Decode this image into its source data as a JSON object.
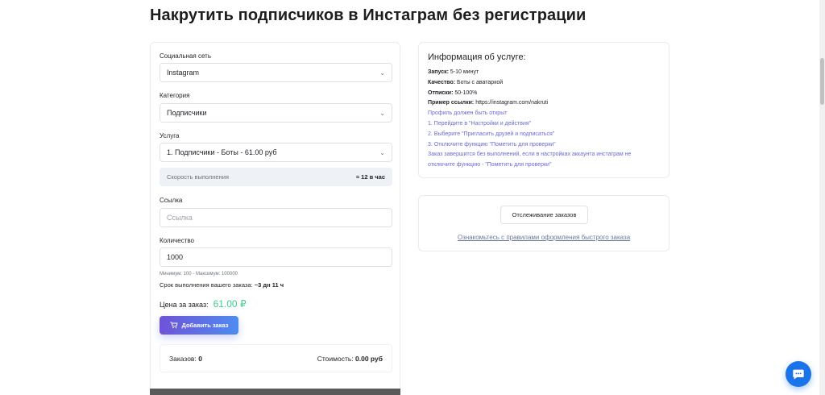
{
  "page": {
    "title": "Накрутить подписчиков в Инстаграм без регистрации"
  },
  "form": {
    "network_label": "Социальная сеть",
    "network_value": "Instagram",
    "category_label": "Категория",
    "category_value": "Подписчики",
    "service_label": "Услуга",
    "service_value": "1. Подписчики - Боты - 61.00 руб",
    "speed_label": "Скорость выполнения",
    "speed_value": "≈ 12 в час",
    "link_label": "Ссылка",
    "link_placeholder": "Ссылка",
    "quantity_label": "Количество",
    "quantity_value": "1000",
    "quantity_hint": "Минимум: 100 - Максимум: 100000",
    "term_label": "Срок выполнения вашего заказа:",
    "term_value": "~3 дн 11 ч",
    "price_label": "Цена за заказ:",
    "price_value": "61.00 ₽",
    "add_button": "Добавить заказ"
  },
  "summary": {
    "orders_label": "Заказов:",
    "orders_value": "0",
    "cost_label": "Стоимость:",
    "cost_value": "0.00 руб"
  },
  "info": {
    "title": "Информация об услуге:",
    "start_label": "Запуск:",
    "start_value": "5-10 минут",
    "quality_label": "Качество:",
    "quality_value": "Боты с аватаркой",
    "unsub_label": "Отписки:",
    "unsub_value": "50-100%",
    "example_label": "Пример ссылки:",
    "example_value": "https://instagram.com/nakruti",
    "notes": [
      "Профиль должен быть открыт",
      "1. Перейдите в \"Настройки и действия\"",
      "2. Выберите \"Пригласить друзей и подписаться\"",
      "3. Отключите функцию \"Пометить для проверки\"",
      "Заказ завершится без выполнений, если в настройках аккаунта инстаграм не",
      "отключите функцию - \"Пометить для проверки\""
    ]
  },
  "tracking": {
    "button": "Отслеживание заказов",
    "rules_link": "Ознакомьтесь с правилами оформления быстрого заказа"
  },
  "icons": {
    "chevron": "chevron-down-icon",
    "cart": "cart-icon",
    "chat": "chat-icon"
  },
  "colors": {
    "accent_gradient_start": "#6f52d8",
    "accent_gradient_end": "#4e8cf0",
    "price": "#3ecf8e",
    "note": "#6a6ad8",
    "chat": "#1a73e8"
  }
}
